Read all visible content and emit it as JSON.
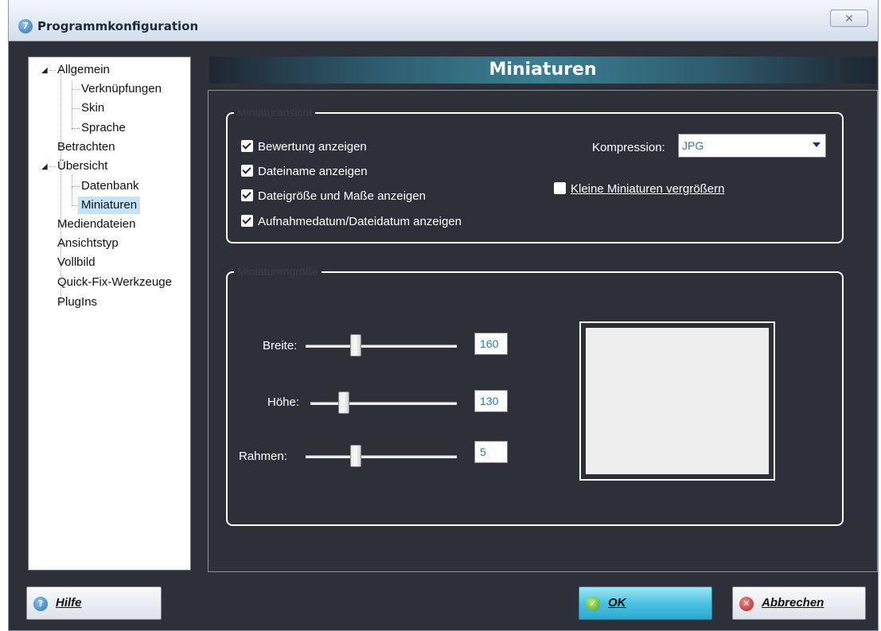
{
  "window": {
    "title": "Programmkonfiguration",
    "close_symbol": "☒"
  },
  "tree": {
    "items": [
      {
        "label": "Allgemein"
      },
      {
        "label": "Verknüpfungen"
      },
      {
        "label": "Skin"
      },
      {
        "label": "Sprache"
      },
      {
        "label": "Betrachten"
      },
      {
        "label": "Übersicht"
      },
      {
        "label": "Datenbank"
      },
      {
        "label": "Miniaturen",
        "selected": true
      },
      {
        "label": "Mediendateien"
      },
      {
        "label": "Ansichtstyp"
      },
      {
        "label": "Vollbild"
      },
      {
        "label": "Quick-Fix-Werkzeuge"
      },
      {
        "label": "PlugIns"
      }
    ]
  },
  "page": {
    "title": "Miniaturen"
  },
  "group_display": {
    "legend": "Miniaturansicht",
    "checks": [
      {
        "label": "Bewertung anzeigen",
        "checked": true
      },
      {
        "label": "Dateiname anzeigen",
        "checked": true
      },
      {
        "label": "Dateigröße und Maße anzeigen",
        "checked": true
      },
      {
        "label": "Aufnahmedatum/Dateidatum anzeigen",
        "checked": true
      }
    ],
    "compression_label": "Kompression:",
    "compression_value": "JPG",
    "enlarge_label": "Kleine Miniaturen vergrößern",
    "enlarge_checked": false
  },
  "group_size": {
    "legend": "Miniaturengröße",
    "width_label": "Breite:",
    "width_value": "160",
    "height_label": "Höhe:",
    "height_value": "130",
    "border_label": "Rahmen:",
    "border_value": "5"
  },
  "buttons": {
    "help": "Hilfe",
    "ok": "OK",
    "cancel": "Abbrechen"
  },
  "colors": {
    "accent": "#3a7f93",
    "background": "#2d3038",
    "selection": "#c5e3f8"
  }
}
